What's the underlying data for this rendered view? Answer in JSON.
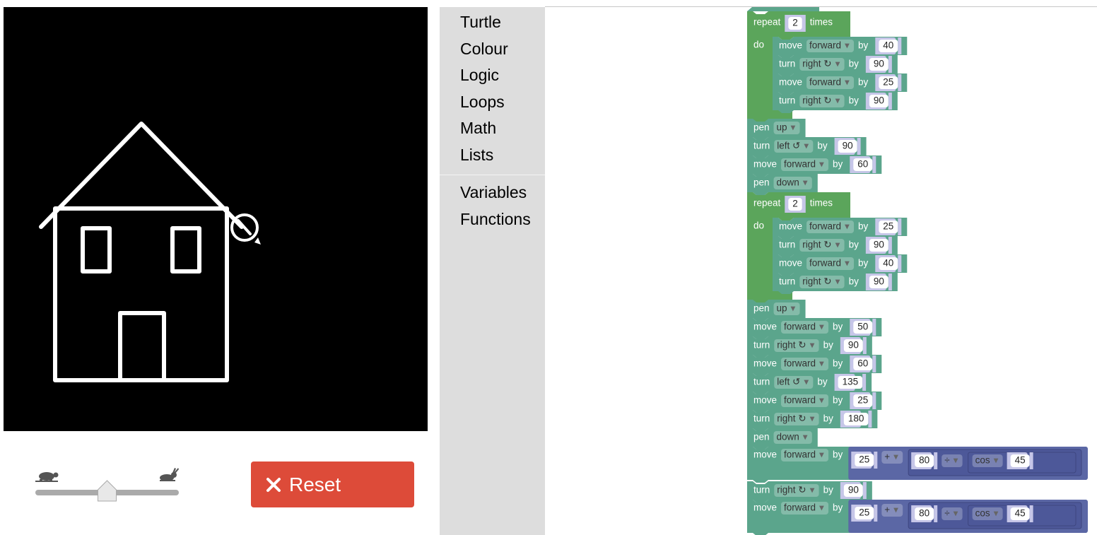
{
  "toolbox": {
    "categories": [
      "Turtle",
      "Colour",
      "Logic",
      "Loops",
      "Math",
      "Lists"
    ],
    "more_categories": [
      "Variables",
      "Functions"
    ]
  },
  "controls": {
    "slow_icon": "turtle-icon",
    "fast_icon": "rabbit-icon",
    "speed_fraction": 0.5,
    "reset_label": "Reset",
    "reset_icon": "close-icon",
    "reset_color": "#dd4b39"
  },
  "colors": {
    "turtle_block": "#5ba58c",
    "loop_block": "#5ba55b",
    "math_block": "#5b67a5",
    "number_shadow": "#c6c6e8",
    "canvas_bg": "#000000",
    "drawing": "#ffffff"
  },
  "program": [
    {
      "kind": "repeat",
      "label": "repeat",
      "count": "2",
      "suffix": "times",
      "do_label": "do",
      "body": [
        {
          "kind": "move",
          "label": "move",
          "dir": "forward",
          "by": "by",
          "value": "40"
        },
        {
          "kind": "turn",
          "label": "turn",
          "dir": "right ↻",
          "by": "by",
          "value": "90"
        },
        {
          "kind": "move",
          "label": "move",
          "dir": "forward",
          "by": "by",
          "value": "25"
        },
        {
          "kind": "turn",
          "label": "turn",
          "dir": "right ↻",
          "by": "by",
          "value": "90"
        }
      ]
    },
    {
      "kind": "pen",
      "label": "pen",
      "dir": "up"
    },
    {
      "kind": "turn",
      "label": "turn",
      "dir": "left ↺",
      "by": "by",
      "value": "90"
    },
    {
      "kind": "move",
      "label": "move",
      "dir": "forward",
      "by": "by",
      "value": "60"
    },
    {
      "kind": "pen",
      "label": "pen",
      "dir": "down"
    },
    {
      "kind": "repeat",
      "label": "repeat",
      "count": "2",
      "suffix": "times",
      "do_label": "do",
      "body": [
        {
          "kind": "move",
          "label": "move",
          "dir": "forward",
          "by": "by",
          "value": "25"
        },
        {
          "kind": "turn",
          "label": "turn",
          "dir": "right ↻",
          "by": "by",
          "value": "90"
        },
        {
          "kind": "move",
          "label": "move",
          "dir": "forward",
          "by": "by",
          "value": "40"
        },
        {
          "kind": "turn",
          "label": "turn",
          "dir": "right ↻",
          "by": "by",
          "value": "90"
        }
      ]
    },
    {
      "kind": "pen",
      "label": "pen",
      "dir": "up"
    },
    {
      "kind": "move",
      "label": "move",
      "dir": "forward",
      "by": "by",
      "value": "50"
    },
    {
      "kind": "turn",
      "label": "turn",
      "dir": "right ↻",
      "by": "by",
      "value": "90"
    },
    {
      "kind": "move",
      "label": "move",
      "dir": "forward",
      "by": "by",
      "value": "60"
    },
    {
      "kind": "turn",
      "label": "turn",
      "dir": "left ↺",
      "by": "by",
      "value": "135"
    },
    {
      "kind": "move",
      "label": "move",
      "dir": "forward",
      "by": "by",
      "value": "25"
    },
    {
      "kind": "turn",
      "label": "turn",
      "dir": "right ↻",
      "by": "by",
      "value": "180"
    },
    {
      "kind": "pen",
      "label": "pen",
      "dir": "down"
    },
    {
      "kind": "move_expr",
      "label": "move",
      "dir": "forward",
      "by": "by",
      "a": "25",
      "op": "+",
      "b": "80",
      "op2": "÷",
      "fn": "cos",
      "c": "45"
    },
    {
      "kind": "turn",
      "label": "turn",
      "dir": "right ↻",
      "by": "by",
      "value": "90"
    },
    {
      "kind": "move_expr",
      "label": "move",
      "dir": "forward",
      "by": "by",
      "a": "25",
      "op": "+",
      "b": "80",
      "op2": "÷",
      "fn": "cos",
      "c": "45"
    }
  ]
}
